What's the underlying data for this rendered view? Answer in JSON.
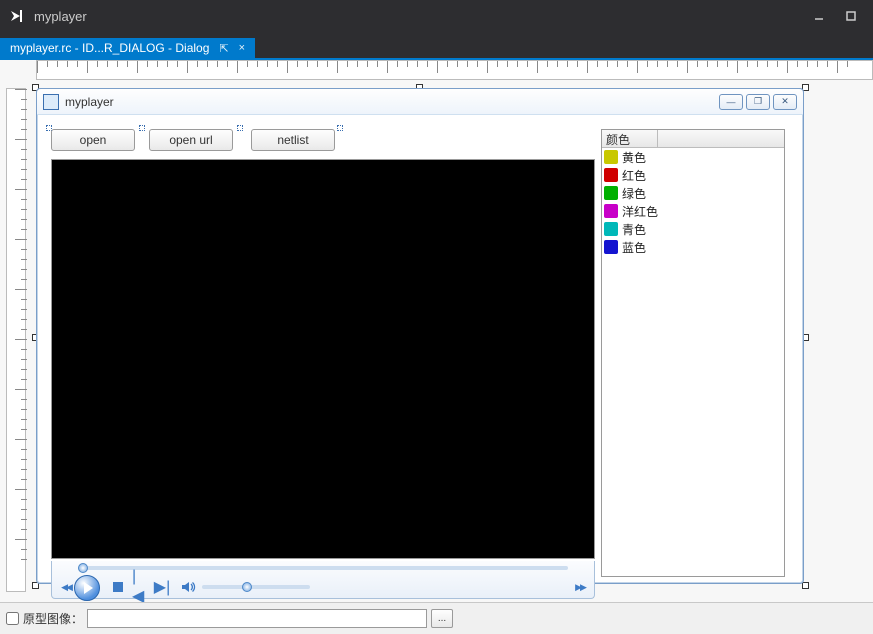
{
  "vs": {
    "title": "myplayer"
  },
  "tab": {
    "label": "myplayer.rc - ID...R_DIALOG - Dialog",
    "pin_glyph": "⇱",
    "close_glyph": "×"
  },
  "dialog": {
    "title": "myplayer",
    "buttons": {
      "open": "open",
      "open_url": "open url",
      "netlist": "netlist"
    },
    "sysbtn": {
      "min": "—",
      "max": "❐",
      "close": "✕"
    }
  },
  "listview": {
    "header": "颜色",
    "rows": [
      {
        "label": "黄色",
        "color": "#c8c800"
      },
      {
        "label": "红色",
        "color": "#d00000"
      },
      {
        "label": "绿色",
        "color": "#00b000"
      },
      {
        "label": "洋红色",
        "color": "#c800c8"
      },
      {
        "label": "青色",
        "color": "#00b8b8"
      },
      {
        "label": "蓝色",
        "color": "#1414d0"
      }
    ]
  },
  "prop": {
    "label": "原型图像：",
    "ellipsis": "..."
  }
}
